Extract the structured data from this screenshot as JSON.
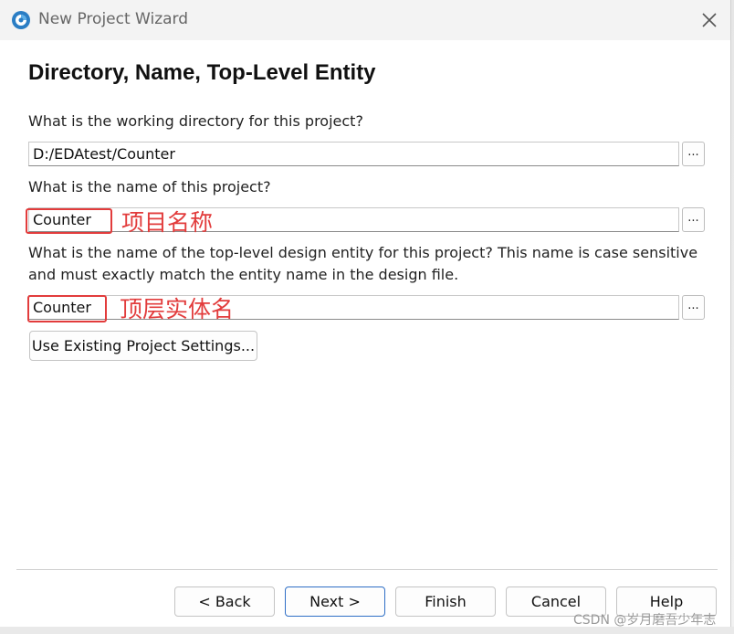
{
  "window": {
    "title": "New Project Wizard",
    "page_title": "Directory, Name, Top-Level Entity"
  },
  "fields": {
    "directory": {
      "label": "What is the working directory for this project?",
      "value": "D:/EDAtest/Counter",
      "browse_label": "..."
    },
    "project_name": {
      "label": "What is the name of this project?",
      "value": "Counter",
      "browse_label": "..."
    },
    "top_entity": {
      "label_line1": "What is the name of the top-level design entity for this project? This name is case sensitive",
      "label_line2": "and must exactly match the entity name in the design file.",
      "value": "Counter",
      "browse_label": "..."
    }
  },
  "use_existing_button": "Use Existing Project Settings...",
  "annotations": {
    "project_name_note": "项目名称",
    "top_entity_note": "顶层实体名"
  },
  "footer": {
    "back": "< Back",
    "next": "Next >",
    "finish": "Finish",
    "cancel": "Cancel",
    "help": "Help"
  },
  "watermark": "CSDN @岁月磨吾少年志",
  "colors": {
    "annotation": "#e23c3c",
    "primary_border": "#2f6fc6",
    "titlebar": "#f3f3f3"
  },
  "icons": {
    "app": "quartus-app-icon",
    "close": "close-icon"
  }
}
